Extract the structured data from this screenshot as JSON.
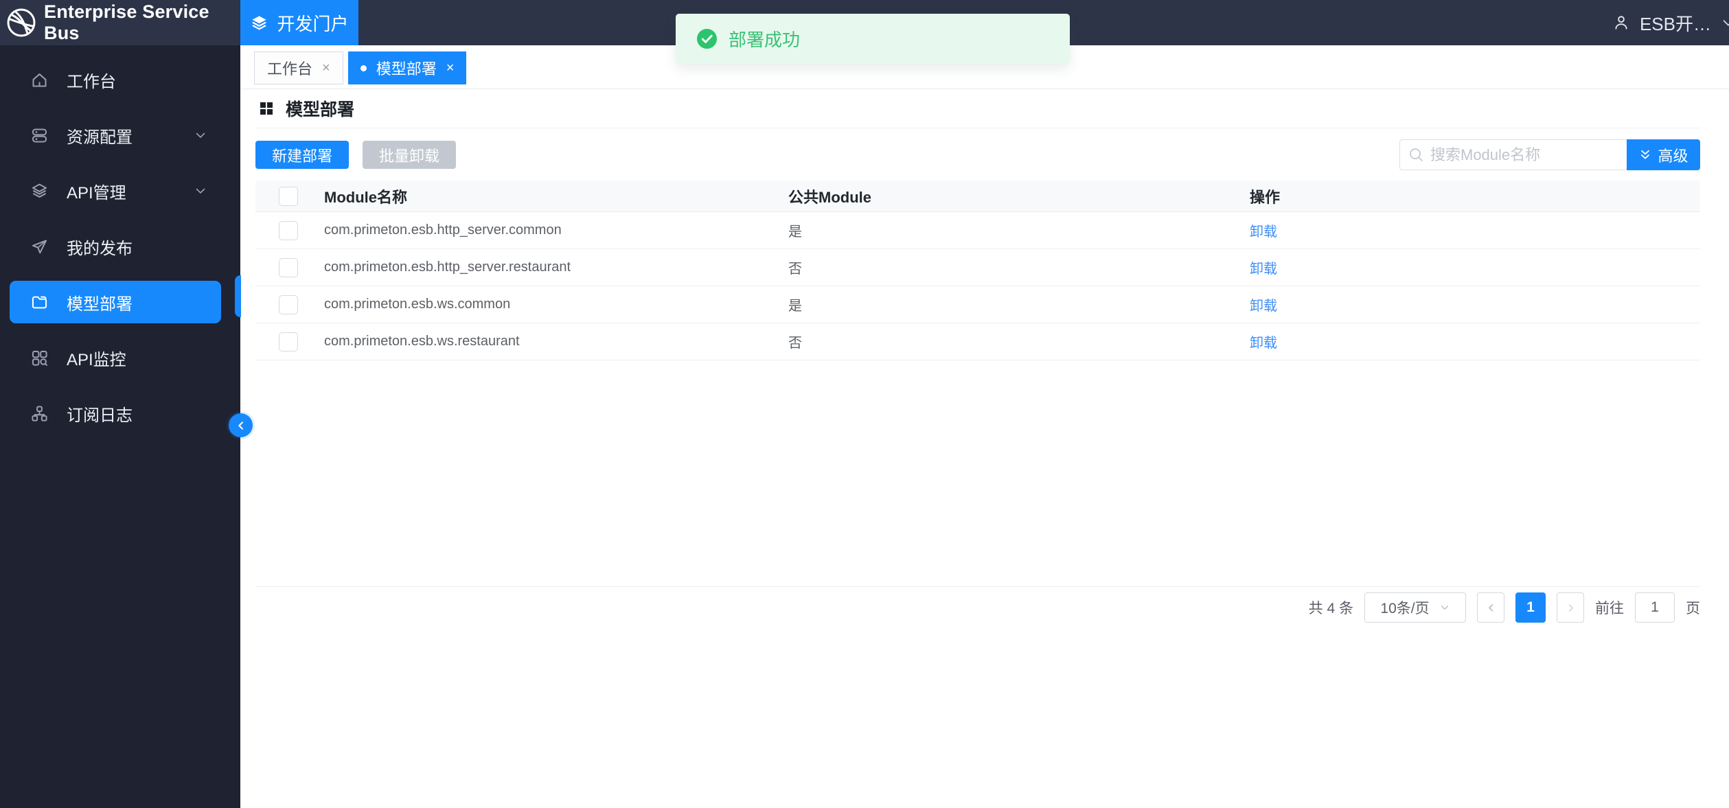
{
  "header": {
    "logo_text": "Enterprise Service Bus",
    "portal_tab_label": "开发门户",
    "user_name": "ESB开…"
  },
  "toast": {
    "message": "部署成功"
  },
  "sidebar": {
    "items": [
      {
        "label": "工作台",
        "icon": "home-icon",
        "active": false,
        "has_arrow": false
      },
      {
        "label": "资源配置",
        "icon": "server-icon",
        "active": false,
        "has_arrow": true
      },
      {
        "label": "API管理",
        "icon": "layers-icon",
        "active": false,
        "has_arrow": true
      },
      {
        "label": "我的发布",
        "icon": "paper-plane-icon",
        "active": false,
        "has_arrow": false
      },
      {
        "label": "模型部署",
        "icon": "folder-icon",
        "active": true,
        "has_arrow": false
      },
      {
        "label": "API监控",
        "icon": "monitor-grid-icon",
        "active": false,
        "has_arrow": false
      },
      {
        "label": "订阅日志",
        "icon": "org-chart-icon",
        "active": false,
        "has_arrow": false
      }
    ]
  },
  "tabs": [
    {
      "label": "工作台",
      "active": false
    },
    {
      "label": "模型部署",
      "active": true
    }
  ],
  "page": {
    "title": "模型部署",
    "new_deploy_label": "新建部署",
    "batch_unload_label": "批量卸载",
    "search_placeholder": "搜索Module名称",
    "advanced_label": "高级"
  },
  "table": {
    "columns": {
      "name": "Module名称",
      "public": "公共Module",
      "action": "操作"
    },
    "rows": [
      {
        "name": "com.primeton.esb.http_server.common",
        "public": "是",
        "action": "卸载"
      },
      {
        "name": "com.primeton.esb.http_server.restaurant",
        "public": "否",
        "action": "卸载"
      },
      {
        "name": "com.primeton.esb.ws.common",
        "public": "是",
        "action": "卸载"
      },
      {
        "name": "com.primeton.esb.ws.restaurant",
        "public": "否",
        "action": "卸载"
      }
    ]
  },
  "pagination": {
    "total_label": "共 4 条",
    "page_size_label": "10条/页",
    "current_page": "1",
    "goto_label": "前往",
    "goto_value": "1",
    "page_unit_label": "页"
  },
  "colors": {
    "primary_blue": "#1789fd",
    "header_bg": "#2d3447",
    "sidebar_bg": "#1f2230",
    "success_green": "#39c175",
    "link_blue": "#3f8ef6",
    "disabled_gray": "#c3c8d0"
  }
}
